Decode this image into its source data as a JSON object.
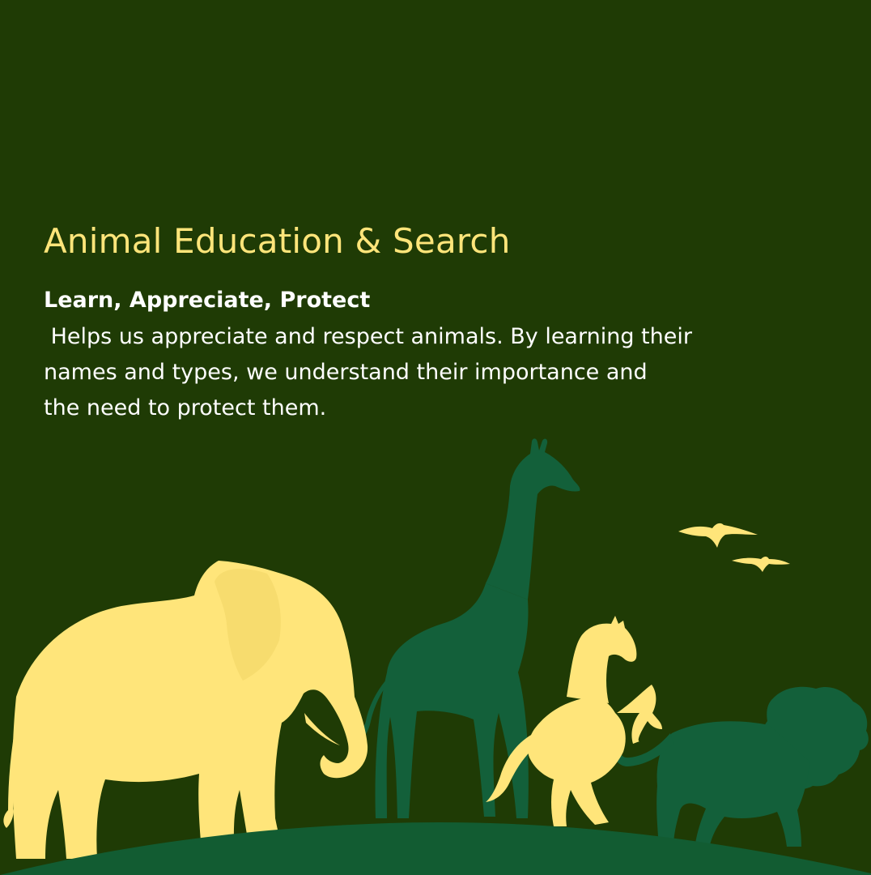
{
  "headline": "Animal Education & Search",
  "subheading": "Learn, Appreciate, Protect",
  "body_lines": [
    " Helps us appreciate and respect animals. By learning their",
    "names and types, we understand their importance and",
    "the need to protect them."
  ],
  "colors": {
    "background": "#1f3b05",
    "accent_yellow": "#ffe57a",
    "silhouette_green": "#13603a",
    "hill_green": "#125c32",
    "text_white": "#ffffff"
  },
  "illustration": {
    "subjects": [
      "elephant-silhouette",
      "giraffe-silhouette",
      "rearing-horse-silhouette",
      "lion-silhouette",
      "bird-silhouette",
      "bird-silhouette"
    ]
  }
}
